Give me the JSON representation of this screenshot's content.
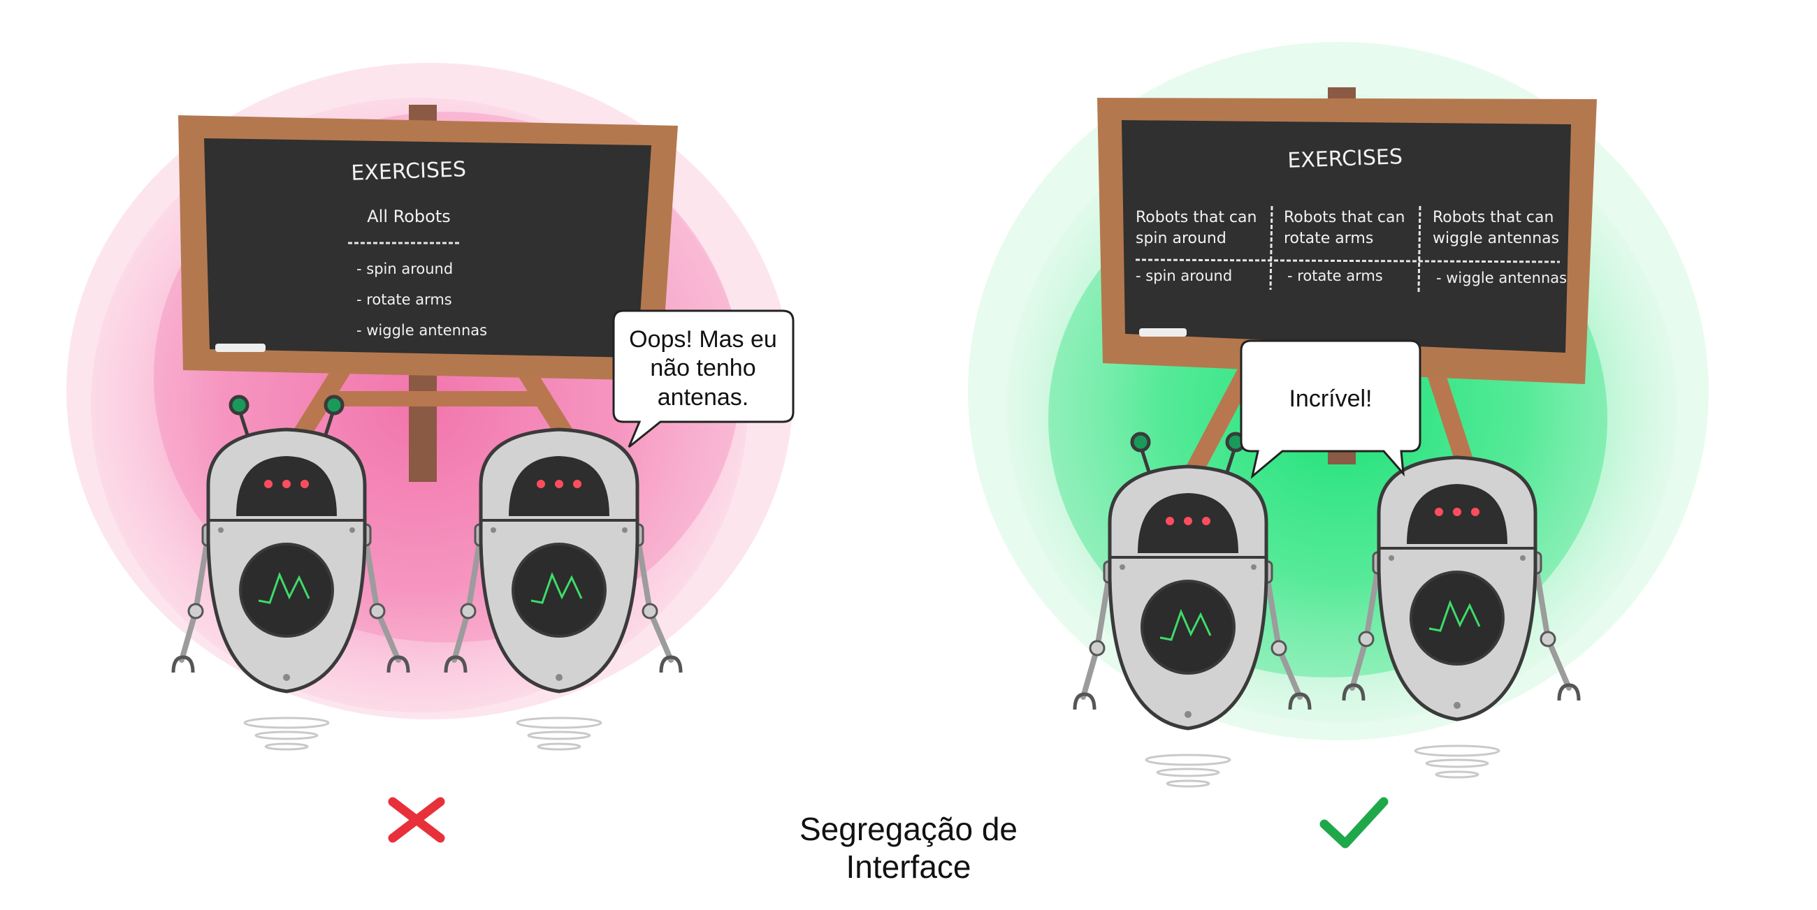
{
  "left_panel": {
    "board": {
      "title": "EXERCISES",
      "subtitle": "All Robots",
      "items": [
        "- spin around",
        "- rotate arms",
        "- wiggle antennas"
      ]
    },
    "speech": [
      "Oops! Mas eu",
      "não tenho",
      "antenas."
    ],
    "status_icon": "cross-icon",
    "background_color": "#f48fb1",
    "status_color": "#e8303a"
  },
  "right_panel": {
    "board": {
      "title": "EXERCISES",
      "columns": [
        {
          "header": [
            "Robots that can",
            "spin around"
          ],
          "item": "- spin around"
        },
        {
          "header": [
            "Robots that can",
            "rotate arms"
          ],
          "item": "- rotate arms"
        },
        {
          "header": [
            "Robots that can",
            "wiggle antennas"
          ],
          "item": "- wiggle antennas"
        }
      ]
    },
    "speech": "Incrível!",
    "status_icon": "checkmark-icon",
    "background_color": "#2ee67a",
    "status_color": "#1fa84a"
  },
  "caption": "Segregação de Interface"
}
